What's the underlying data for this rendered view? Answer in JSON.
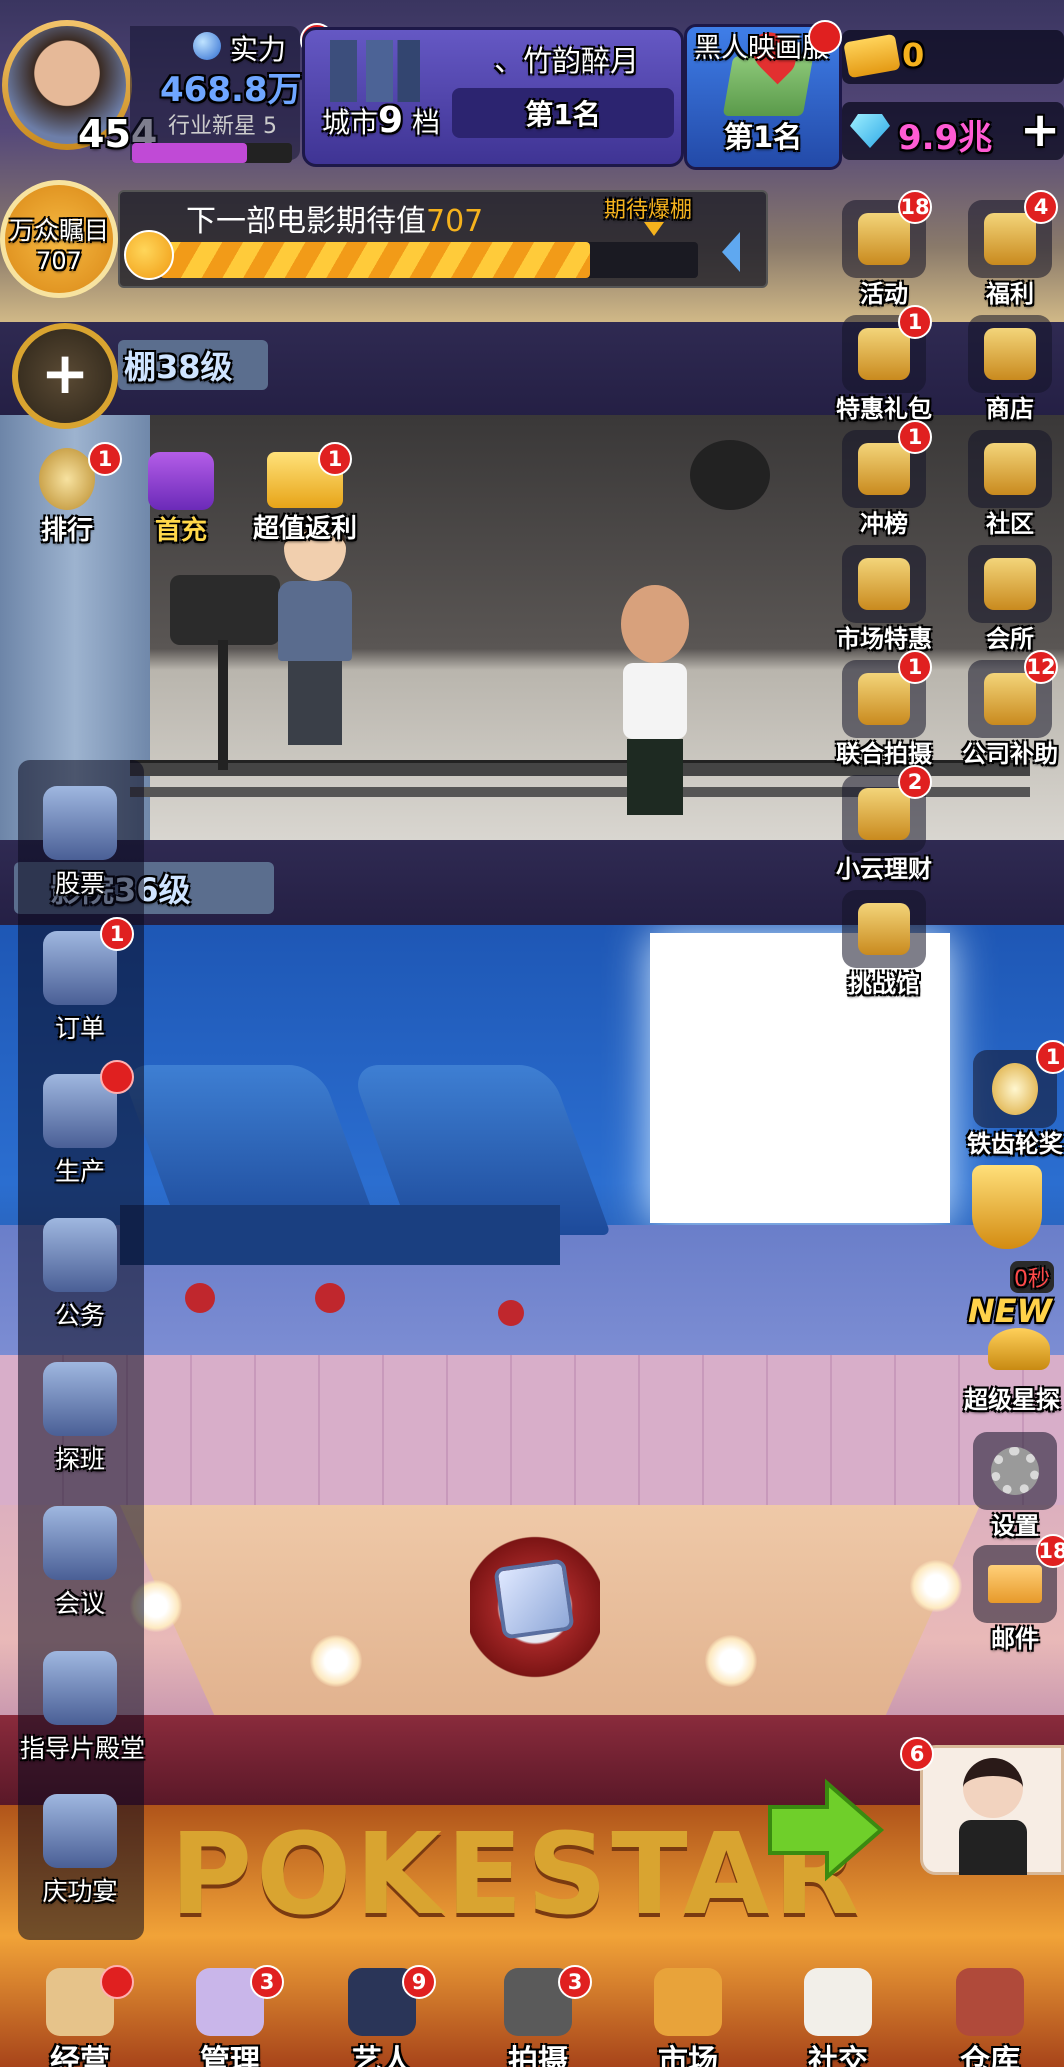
{
  "header": {
    "level_value": "454",
    "power_label": "实力",
    "power_value": "468.8万",
    "rank_title": "行业新星 5",
    "city_label": "城市",
    "city_tier_num": "9",
    "city_tier_suffix": "档",
    "city_badge": "1",
    "player_name": "、竹韵醉月",
    "player_rank": "第1名",
    "server_label": "黑人映画服",
    "server_rank": "第1名",
    "tickets_value": "0",
    "diamonds_value": "9.9兆",
    "add_symbol": "+"
  },
  "anticipation": {
    "circle_title": "万众瞩目",
    "circle_value": "707",
    "text_prefix": "下一部电影期待值",
    "text_value": "707",
    "marker_label": "期待爆棚",
    "progress_fraction": 0.8
  },
  "studio": {
    "add_symbol": "+",
    "level_label": "棚38级",
    "quick": [
      {
        "label": "排行",
        "badge": "1"
      },
      {
        "label": "首充",
        "badge": ""
      },
      {
        "label": "超值返利",
        "badge": "1"
      }
    ]
  },
  "cinema": {
    "level_label": "影院36级"
  },
  "right_menu": [
    {
      "label": "活动",
      "badge": "18",
      "icon": "gift-box-icon"
    },
    {
      "label": "福利",
      "badge": "4",
      "icon": "money-bag-icon"
    },
    {
      "label": "特惠礼包",
      "badge": "1",
      "icon": "gift-pack-icon"
    },
    {
      "label": "商店",
      "badge": "",
      "icon": "shop-icon"
    },
    {
      "label": "冲榜",
      "badge": "1",
      "icon": "clapper-icon"
    },
    {
      "label": "社区",
      "badge": "",
      "icon": "chat-icon"
    },
    {
      "label": "市场特惠",
      "badge": "",
      "icon": "market-icon"
    },
    {
      "label": "会所",
      "badge": "",
      "icon": "clubhouse-icon"
    },
    {
      "label": "联合拍摄",
      "badge": "1",
      "icon": "co-shoot-icon"
    },
    {
      "label": "公司补助",
      "badge": "12",
      "icon": "megaphone-icon"
    },
    {
      "label": "小云理财",
      "badge": "2",
      "icon": "safe-icon"
    },
    {
      "label": "挑战馆",
      "badge": "",
      "icon": "building-icon"
    }
  ],
  "right_lower": {
    "gear_award": "铁齿轮奖",
    "gear_award_badge": "1",
    "trophy_timer": "0秒",
    "new_tag": "NEW",
    "scout": "超级星探",
    "settings": "设置",
    "mail": "邮件",
    "mail_badge": "18"
  },
  "left_menu": [
    {
      "label": "股票",
      "badge": "",
      "icon": "stock-chart-icon"
    },
    {
      "label": "订单",
      "badge": "1",
      "icon": "handshake-icon"
    },
    {
      "label": "生产",
      "badge": "dot",
      "icon": "factory-icon"
    },
    {
      "label": "公务",
      "badge": "",
      "icon": "phone-icon"
    },
    {
      "label": "探班",
      "badge": "",
      "icon": "flower-bouquet-icon"
    },
    {
      "label": "会议",
      "badge": "",
      "icon": "meeting-icon"
    },
    {
      "label": "指导片殿堂",
      "badge": "",
      "icon": "film-trophy-icon"
    },
    {
      "label": "庆功宴",
      "badge": "",
      "icon": "star-trophy-icon"
    }
  ],
  "stage": {
    "sign_text": "POKESTAR",
    "girl_badge": "6"
  },
  "bottom_nav": [
    {
      "label": "经营",
      "badge": "dot"
    },
    {
      "label": "管理",
      "badge": "3"
    },
    {
      "label": "艺人",
      "badge": "9"
    },
    {
      "label": "拍摄",
      "badge": "3"
    },
    {
      "label": "市场",
      "badge": ""
    },
    {
      "label": "社交",
      "badge": ""
    },
    {
      "label": "仓库",
      "badge": ""
    }
  ],
  "colors": {
    "gold": "#f5b21d",
    "diamond": "#ff5bd4",
    "badge_red": "#e02020",
    "panel_purple": "#4b3f9c"
  }
}
